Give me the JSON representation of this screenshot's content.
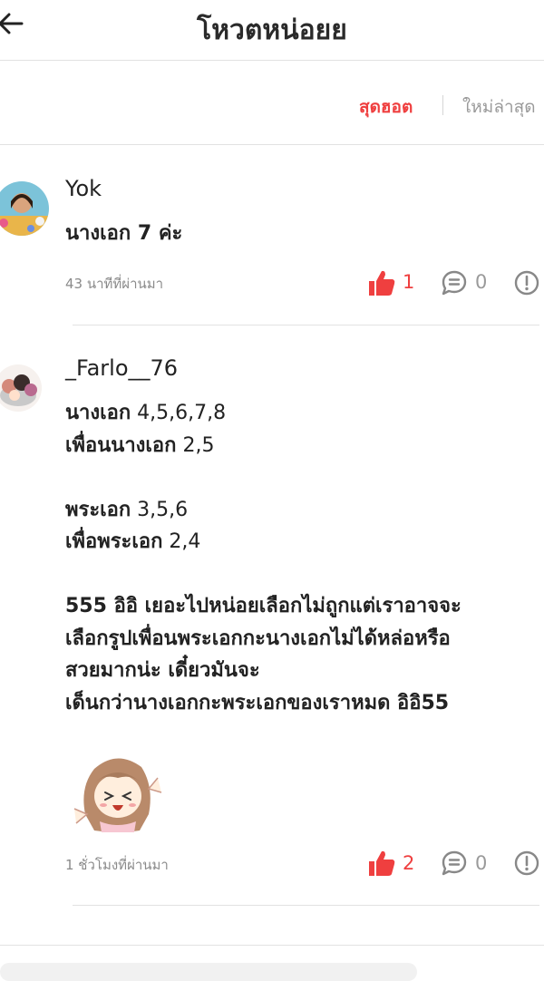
{
  "header": {
    "title": "โหวตหน่อยย"
  },
  "sort": {
    "hot": "สุดฮอต",
    "new": "ใหม่ล่าสุด"
  },
  "comments": [
    {
      "username": "Yok",
      "text": "นางเอก 7 ค่ะ",
      "time": "43 นาทีที่ผ่านมา",
      "likes": "1",
      "replies": "0"
    },
    {
      "username": "_Farlo__76",
      "text": "นางเอก 4,5,6,7,8\nเพื่อนนางเอก 2,5\n\nพระเอก 3,5,6\nเพื่อพระเอก 2,4\n\n555 อิอิ เยอะไปหน่อยเลือกไม่ถูกแต่เราอาจจะ\nเลือกรูปเพื่อนพระเอกกะนางเอกไม่ได้หล่อหรือ\nสวยมากน่ะ เดี๋ยวมันจะ\nเด็นกว่านางเอกกะพระเอกของเราหมด อิอิ55",
      "time": "1 ชั่วโมงที่ผ่านมา",
      "likes": "2",
      "replies": "0"
    }
  ],
  "colors": {
    "accent": "#ef3f3f",
    "muted": "#9a9a9a",
    "divider": "#e2e2e2"
  },
  "icons": [
    "back-arrow-icon",
    "thumbs-up-icon",
    "reply-bubble-icon",
    "report-icon",
    "sticker-image"
  ]
}
